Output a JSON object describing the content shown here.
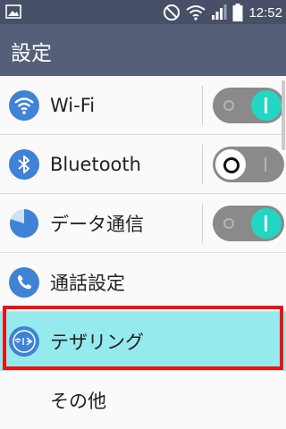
{
  "status_bar": {
    "time": "12:52",
    "icons": [
      "image-icon",
      "do-not-disturb-icon",
      "wifi-icon",
      "signal-icon",
      "battery-icon"
    ]
  },
  "app_bar": {
    "title": "設定"
  },
  "settings": {
    "items": [
      {
        "label": "Wi-Fi",
        "icon": "wifi-icon",
        "toggle": "on"
      },
      {
        "label": "Bluetooth",
        "icon": "bluetooth-icon",
        "toggle": "off"
      },
      {
        "label": "データ通信",
        "icon": "data-usage-icon",
        "toggle": "on"
      },
      {
        "label": "通話設定",
        "icon": "phone-icon"
      },
      {
        "label": "テザリング",
        "icon": "tethering-icon",
        "highlighted": true
      },
      {
        "label": "その他"
      }
    ]
  },
  "colors": {
    "status_bar": "#475066",
    "app_bar": "#556078",
    "icon_blue": "#3f82d6",
    "toggle_on": "#21d7c4",
    "toggle_track": "#8a8a8a",
    "highlight_bg": "#95eaee",
    "highlight_border": "#ee1111"
  }
}
